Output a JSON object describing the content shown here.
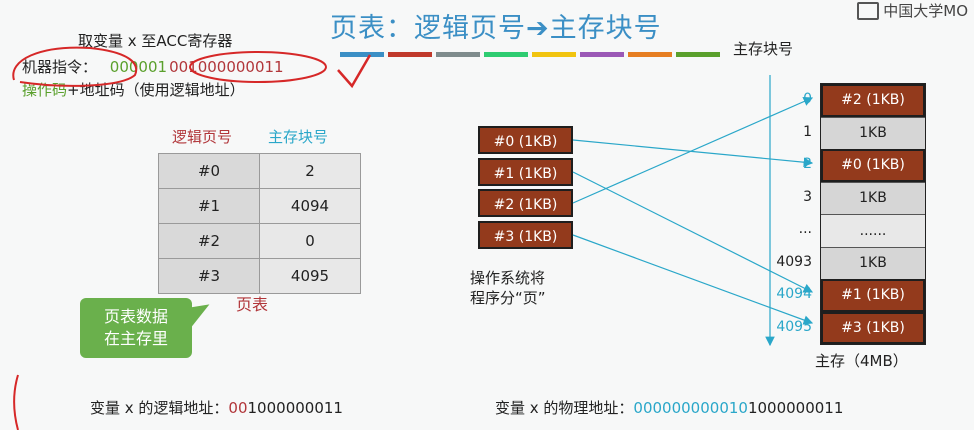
{
  "title": "页表：逻辑页号➔主存块号",
  "logo_text": "中国大学MO",
  "stripe_colors": [
    "#3b8fc5",
    "#c0392b",
    "#7f8c8d",
    "#2ecc71",
    "#f1c40f",
    "#9b59b6",
    "#e67e22",
    "#5aa02c"
  ],
  "instruction": {
    "caption": "取变量 x 至ACC寄存器",
    "label": "机器指令：",
    "opcode": "000001",
    "address": "001000000011",
    "legend_op": "操作码",
    "legend_rest": "+地址码（使用逻辑地址）"
  },
  "page_table": {
    "col_logical": "逻辑页号",
    "col_block": "主存块号",
    "rows": [
      {
        "page": "#0",
        "block": "2"
      },
      {
        "page": "#1",
        "block": "4094"
      },
      {
        "page": "#2",
        "block": "0"
      },
      {
        "page": "#3",
        "block": "4095"
      }
    ],
    "name": "页表",
    "callout": [
      "页表数据",
      "在主存里"
    ]
  },
  "pages": [
    "#0 (1KB)",
    "#1 (1KB)",
    "#2 (1KB)",
    "#3 (1KB)"
  ],
  "pages_caption": [
    "操作系统将",
    "程序分“页”"
  ],
  "memory": {
    "heading": "主存块号",
    "cells": [
      {
        "addr": "0",
        "label": "#2 (1KB)",
        "kind": "used",
        "addr_color": "cyan"
      },
      {
        "addr": "1",
        "label": "1KB",
        "kind": "free",
        "addr_color": "dark"
      },
      {
        "addr": "2",
        "label": "#0 (1KB)",
        "kind": "used",
        "addr_color": "cyan"
      },
      {
        "addr": "3",
        "label": "1KB",
        "kind": "free",
        "addr_color": "dark"
      },
      {
        "addr": "...",
        "label": "......",
        "kind": "dot",
        "addr_color": "dark"
      },
      {
        "addr": "4093",
        "label": "1KB",
        "kind": "free",
        "addr_color": "dark"
      },
      {
        "addr": "4094",
        "label": "#1 (1KB)",
        "kind": "used",
        "addr_color": "cyan"
      },
      {
        "addr": "4095",
        "label": "#3 (1KB)",
        "kind": "used",
        "addr_color": "cyan"
      }
    ],
    "caption": "主存（4MB）"
  },
  "logical_addr": {
    "label": "变量 x 的逻辑地址：",
    "page_bits": "00",
    "offset_bits": "1000000011"
  },
  "physical_addr": {
    "label": "变量 x 的物理地址：",
    "block_bits": "000000000010",
    "offset_bits": "1000000011"
  }
}
